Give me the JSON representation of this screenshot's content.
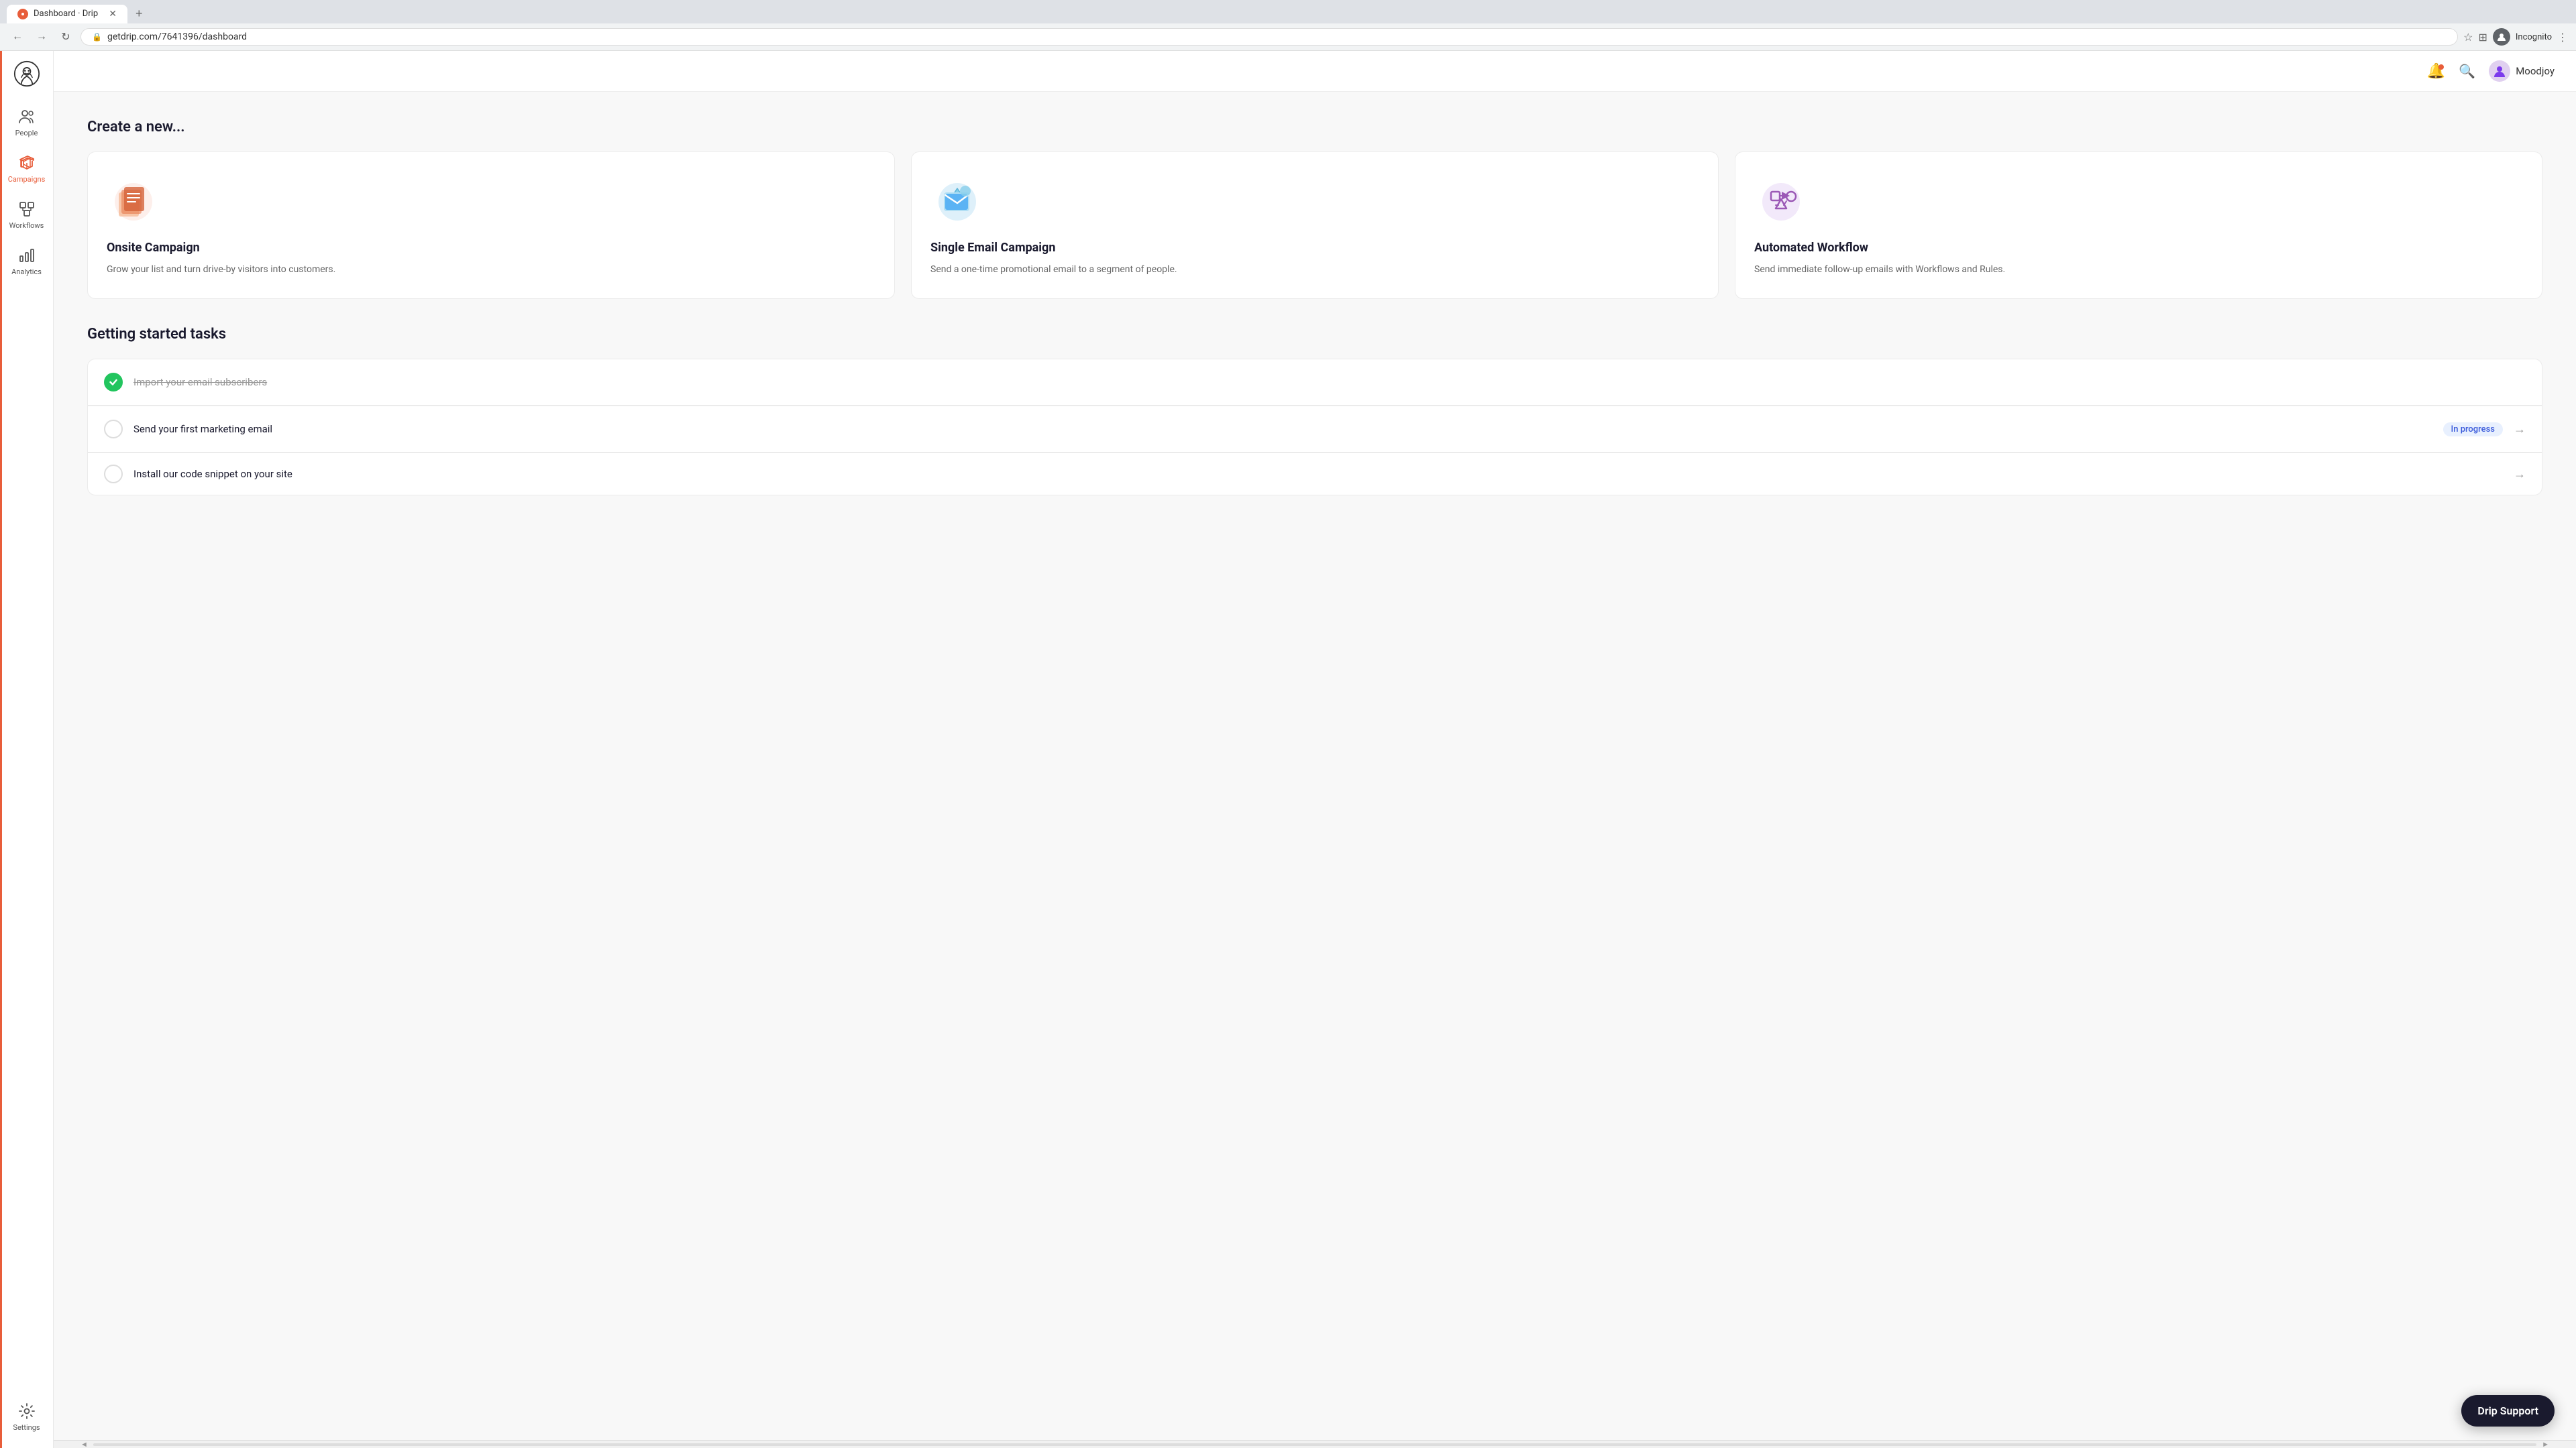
{
  "browser": {
    "tab_title": "Dashboard · Drip",
    "url": "getdrip.com/7641396/dashboard",
    "user_label": "Incognito"
  },
  "sidebar": {
    "logo_alt": "Drip logo",
    "items": [
      {
        "id": "people",
        "label": "People",
        "icon": "people"
      },
      {
        "id": "campaigns",
        "label": "Campaigns",
        "icon": "campaigns",
        "active": true
      },
      {
        "id": "workflows",
        "label": "Workflows",
        "icon": "workflows"
      },
      {
        "id": "analytics",
        "label": "Analytics",
        "icon": "analytics"
      },
      {
        "id": "settings",
        "label": "Settings",
        "icon": "settings"
      }
    ]
  },
  "header": {
    "user_name": "Moodjoy"
  },
  "main": {
    "create_heading": "Create a new...",
    "cards": [
      {
        "id": "onsite",
        "title": "Onsite Campaign",
        "desc": "Grow your list and turn drive-by visitors into customers."
      },
      {
        "id": "single-email",
        "title": "Single Email Campaign",
        "desc": "Send a one-time promotional email to a segment of people."
      },
      {
        "id": "workflow",
        "title": "Automated Workflow",
        "desc": "Send immediate follow-up emails with Workflows and Rules."
      }
    ],
    "tasks_heading": "Getting started tasks",
    "tasks": [
      {
        "id": "import-subscribers",
        "label": "Import your email subscribers",
        "done": true,
        "strikethrough": true,
        "badge": null
      },
      {
        "id": "send-marketing",
        "label": "Send your first marketing email",
        "done": false,
        "strikethrough": false,
        "badge": "In progress",
        "has_arrow": true
      },
      {
        "id": "install-snippet",
        "label": "Install our code snippet on your site",
        "done": false,
        "strikethrough": false,
        "badge": null,
        "has_arrow": true
      }
    ]
  },
  "drip_support": {
    "label": "Drip Support"
  }
}
